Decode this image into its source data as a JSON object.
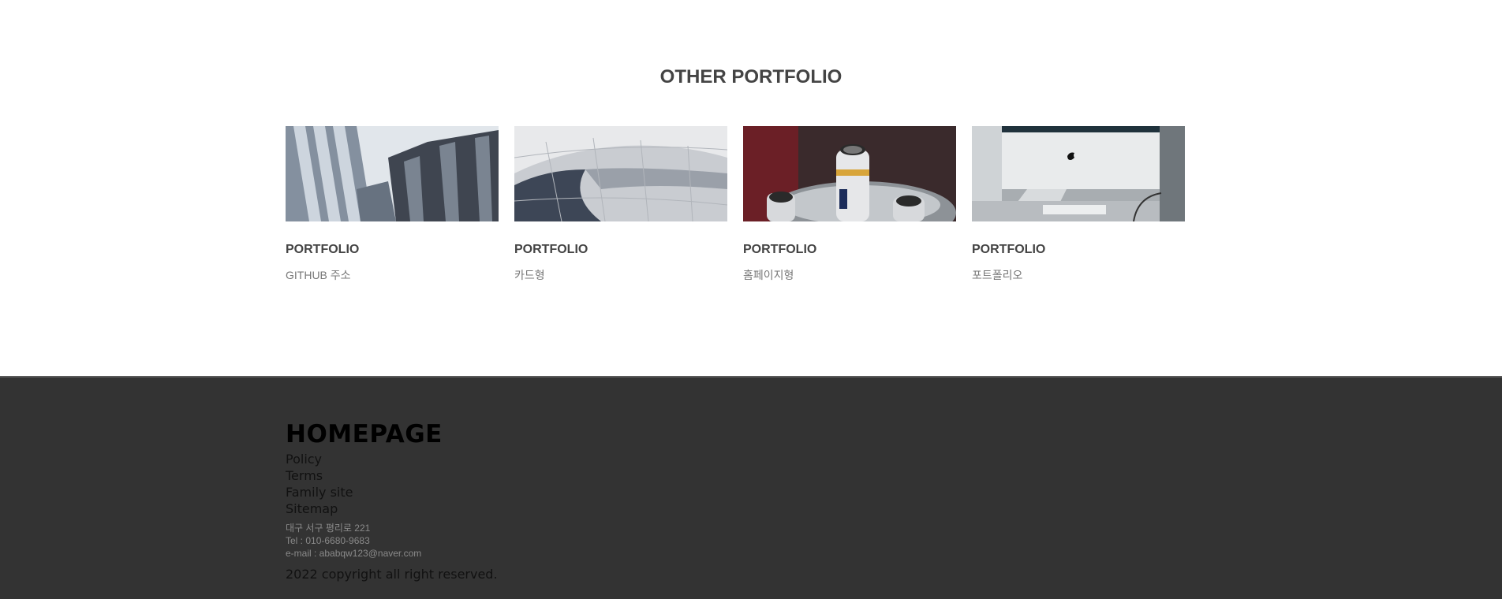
{
  "portfolio": {
    "title": "OTHER PORTFOLIO",
    "cards": [
      {
        "title": "PORTFOLIO",
        "subtitle": "GITHUB 주소",
        "image_icon": "buildings-photo"
      },
      {
        "title": "PORTFOLIO",
        "subtitle": "카드형",
        "image_icon": "metal-facade-photo"
      },
      {
        "title": "PORTFOLIO",
        "subtitle": "홈페이지형",
        "image_icon": "bottles-photo"
      },
      {
        "title": "PORTFOLIO",
        "subtitle": "포트폴리오",
        "image_icon": "imac-photo"
      }
    ]
  },
  "footer": {
    "logo": "HOMEPAGE",
    "links": [
      "Policy",
      "Terms",
      "Family site",
      "Sitemap"
    ],
    "address": "대구 서구 평리로 221",
    "tel": "Tel : 010-6680-9683",
    "email": "e-mail : ababqw123@naver.com",
    "copyright": "2022 copyright all right reserved.",
    "background": "#333333"
  }
}
